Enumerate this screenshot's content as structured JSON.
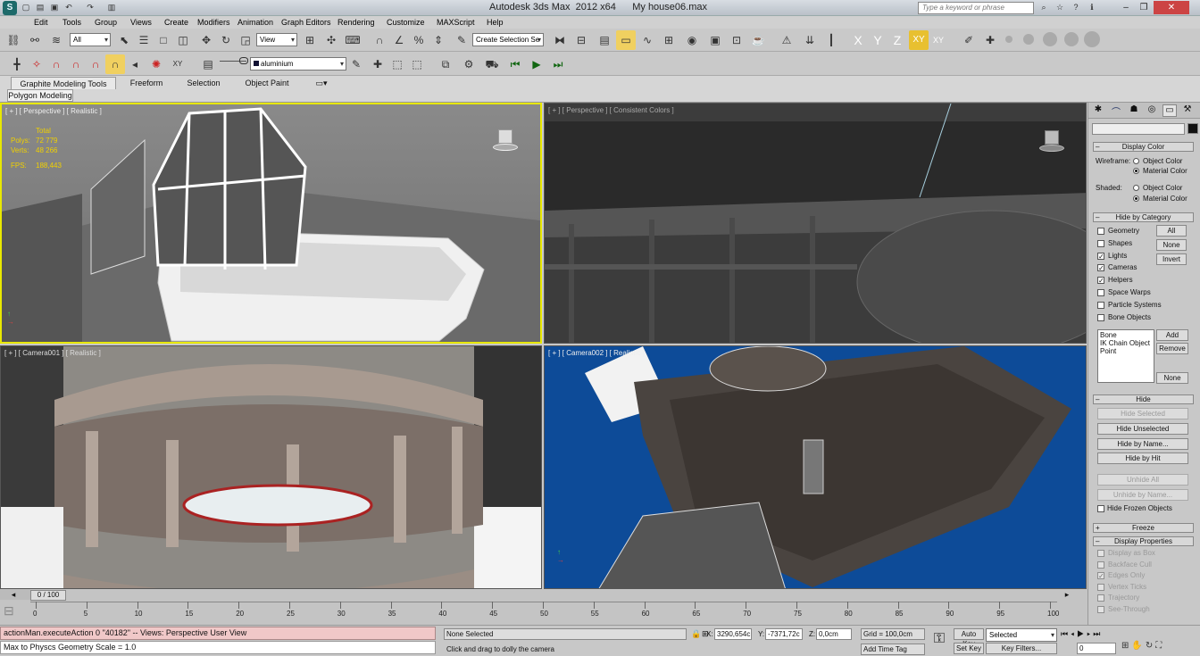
{
  "app": {
    "title": "Autodesk 3ds Max  2012 x64",
    "file": "My house06.max",
    "logo": "max-logo-icon"
  },
  "quick_access": [
    "new-icon",
    "open-icon",
    "save-icon",
    "undo-icon",
    "redo-icon",
    "hold-icon"
  ],
  "search": {
    "placeholder": "Type a keyword or phrase"
  },
  "menu": [
    "Edit",
    "Tools",
    "Group",
    "Views",
    "Create",
    "Modifiers",
    "Animation",
    "Graph Editors",
    "Rendering",
    "Customize",
    "MAXScript",
    "Help"
  ],
  "toolbar1": {
    "filter": "All",
    "ref_coord": "View",
    "named_sel": "Create Selection Se",
    "axes": [
      "X",
      "Y",
      "Z",
      "XY",
      "XY"
    ]
  },
  "toolbar2": {
    "material": "aluminium"
  },
  "ribbon": {
    "tabs": [
      "Graphite Modeling Tools",
      "Freeform",
      "Selection",
      "Object Paint"
    ],
    "subtab": "Polygon Modeling"
  },
  "viewports": {
    "top_left": {
      "label": "[ + ] [ Perspective ] [ Realistic ]",
      "stats": {
        "total": "Total",
        "polys_label": "Polys:",
        "polys": "72 779",
        "verts_label": "Verts:",
        "verts": "48 266",
        "fps_label": "FPS:",
        "fps": "188,443"
      }
    },
    "top_right": {
      "label": "[ + ] [ Perspective ] [ Consistent Colors ]"
    },
    "bottom_left": {
      "label": "[ + ] [ Camera001 ] [ Realistic ]"
    },
    "bottom_right": {
      "label": "[ + ] [ Camera002 ] [ Realistic ]"
    }
  },
  "panel": {
    "tabs": [
      "create-icon",
      "modify-icon",
      "hierarchy-icon",
      "motion-icon",
      "display-icon",
      "utilities-icon"
    ],
    "display_color": {
      "title": "Display Color",
      "wireframe": "Wireframe:",
      "shaded": "Shaded:",
      "object_color": "Object Color",
      "material_color": "Material Color"
    },
    "hide_by_category": {
      "title": "Hide by Category",
      "items": [
        "Geometry",
        "Shapes",
        "Lights",
        "Cameras",
        "Helpers",
        "Space Warps",
        "Particle Systems",
        "Bone Objects"
      ],
      "checked": [
        false,
        false,
        true,
        true,
        true,
        false,
        false,
        false
      ],
      "buttons": [
        "All",
        "None",
        "Invert"
      ],
      "list": [
        "Bone",
        "IK Chain Object",
        "Point"
      ],
      "list_buttons": [
        "Add",
        "Remove",
        "None"
      ]
    },
    "hide": {
      "title": "Hide",
      "buttons": [
        "Hide Selected",
        "Hide Unselected",
        "Hide by Name...",
        "Hide by Hit",
        "Unhide All",
        "Unhide by Name..."
      ],
      "enabled": [
        false,
        true,
        true,
        true,
        false,
        false
      ],
      "frozen": "Hide Frozen Objects"
    },
    "freeze": {
      "title": "Freeze"
    },
    "display_properties": {
      "title": "Display Properties",
      "items": [
        "Display as Box",
        "Backface Cull",
        "Edges Only",
        "Vertex Ticks",
        "Trajectory",
        "See-Through"
      ],
      "checked": [
        false,
        false,
        true,
        false,
        false,
        false
      ]
    }
  },
  "timeline": {
    "frame": "0 / 100",
    "ticks": [
      "0",
      "5",
      "10",
      "15",
      "20",
      "25",
      "30",
      "35",
      "40",
      "45",
      "50",
      "55",
      "60",
      "65",
      "70",
      "75",
      "80",
      "85",
      "90",
      "95",
      "100"
    ]
  },
  "status": {
    "listener1": "actionMan.executeAction 0 \"40182\"  -- Views: Perspective User View",
    "listener2": "Max to Physcs Geometry Scale = 1.0",
    "selection": "None Selected",
    "prompt": "Click and drag to dolly the camera",
    "x_label": "X:",
    "x": "3290,654c",
    "y_label": "Y:",
    "y": "-7371,72c",
    "z_label": "Z:",
    "z": "0,0cm",
    "grid": "Grid = 100,0cm",
    "add_time_tag": "Add Time Tag",
    "auto_key": "Auto Key",
    "set_key": "Set Key",
    "key_mode": "Selected",
    "key_filters": "Key Filters...",
    "current_frame": "0"
  },
  "colors": {
    "active_vp_border": "#e8e800",
    "vp_tl_bg": "#7a7a7a",
    "vp_tr_bg": "#3a3a3a",
    "vp_bl_bg": "#8a8a8a",
    "vp_br_bg": "#0a4a9a",
    "panel_bg": "#c8c8c8",
    "status_red": "#f0c8c8"
  }
}
